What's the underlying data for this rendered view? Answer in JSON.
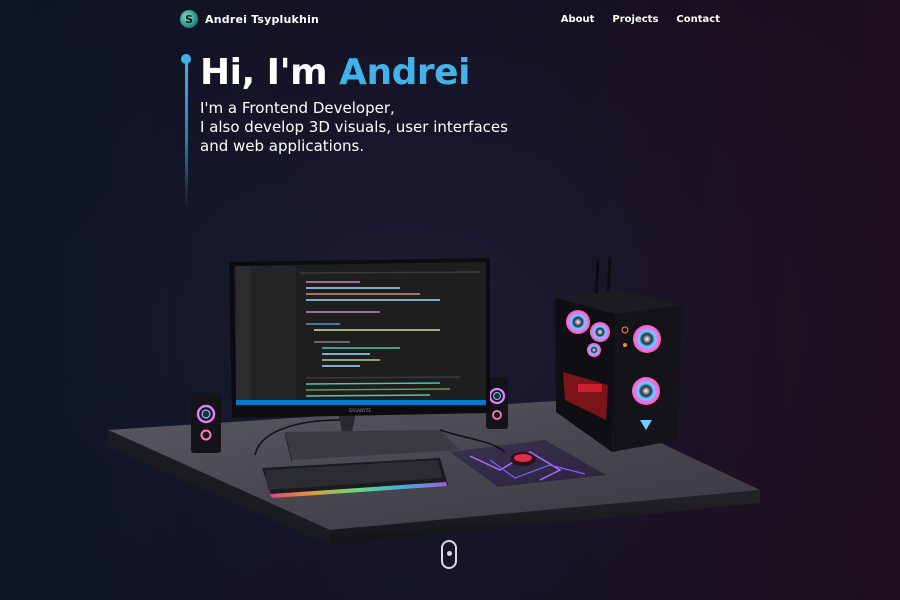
{
  "brand": {
    "name": "Andrei  Tsyplukhin",
    "logo_letter": "S",
    "logo_icon": "brand-logo-icon"
  },
  "nav": {
    "about": "About",
    "projects": "Projects",
    "contact": "Contact"
  },
  "hero": {
    "title_prefix": "Hi, I'm ",
    "title_name": "Andrei",
    "subtitle_lines": [
      "I'm a Frontend Developer,",
      "I also develop 3D visuals, user interfaces",
      "and web applications."
    ]
  },
  "scene": {
    "monitor_brand": "GIGABYTE",
    "editor_filename": "Computers.jsx"
  },
  "colors": {
    "accent": "#41b3ea",
    "text": "#ffffff",
    "background": "#171528"
  },
  "scroll_icon": "mouse-scroll-icon"
}
